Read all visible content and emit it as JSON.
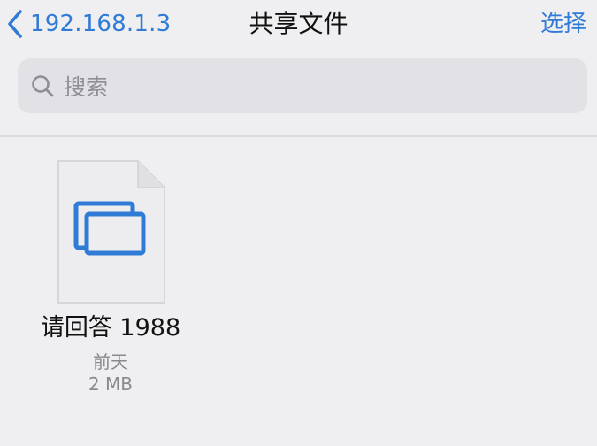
{
  "nav": {
    "back_label": "192.168.1.3",
    "title": "共享文件",
    "select_label": "选择"
  },
  "search": {
    "placeholder": "搜索"
  },
  "files": [
    {
      "name": "请回答 1988",
      "date": "前天",
      "size": "2 MB",
      "icon": "video-files-icon"
    }
  ],
  "colors": {
    "accent": "#2f7bd6",
    "background": "#efeff1",
    "search_field": "#e2e2e6",
    "secondary_text": "#8a8a8e"
  }
}
